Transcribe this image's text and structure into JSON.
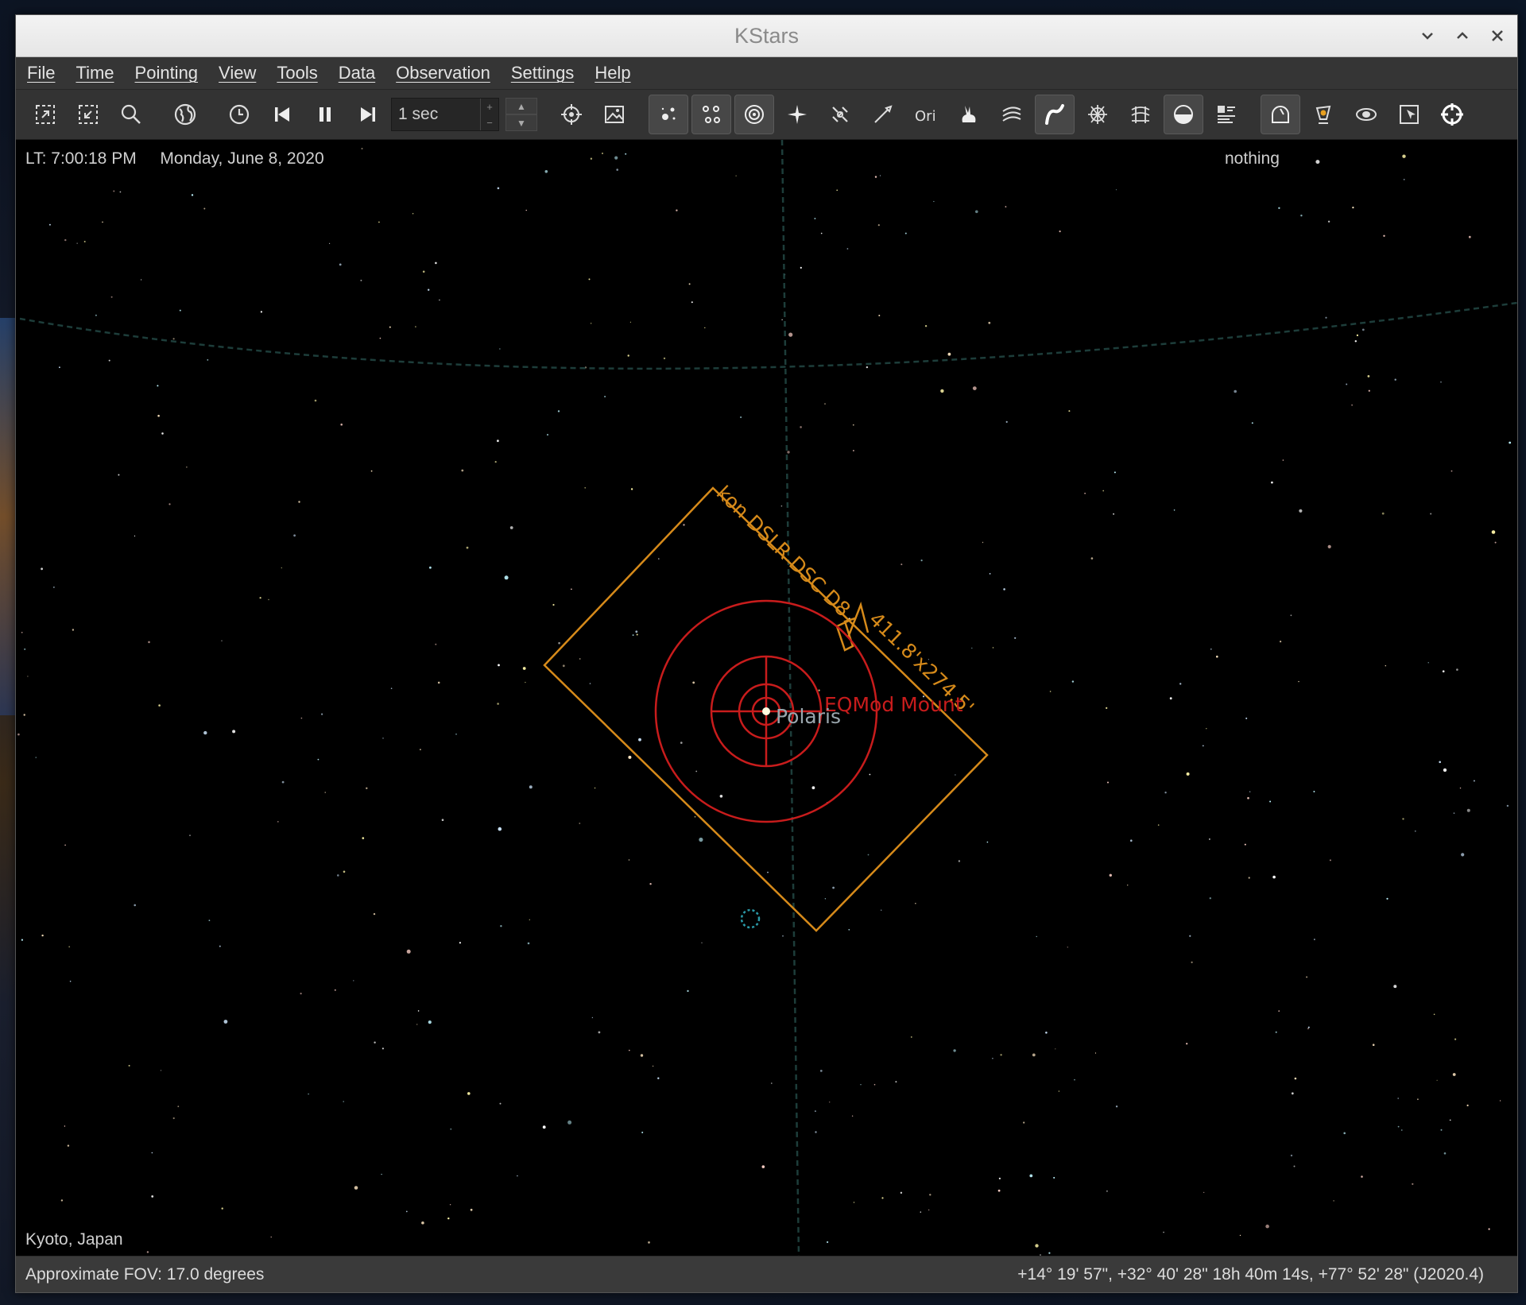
{
  "window": {
    "title": "KStars"
  },
  "menu": [
    "File",
    "Time",
    "Pointing",
    "View",
    "Tools",
    "Data",
    "Observation",
    "Settings",
    "Help"
  ],
  "toolbar": {
    "time_step": "1 sec",
    "icons": [
      "zoom-in-icon",
      "zoom-out-icon",
      "search-icon",
      "globe-icon",
      "clock-icon",
      "skip-back-icon",
      "pause-icon",
      "skip-forward-icon",
      "target-icon",
      "image-icon",
      "stars-icon",
      "constellation-icon",
      "deep-sky-icon",
      "bright-star-icon",
      "satellite-icon",
      "comet-icon",
      "constellation-names-icon",
      "rabbit-icon",
      "milky-way-icon",
      "constellation-lines-icon",
      "grid-icon",
      "equatorial-icon",
      "horizon-icon",
      "details-icon",
      "observatory-icon",
      "telescope-icon",
      "galaxy-icon",
      "export-icon",
      "crosshair-icon"
    ]
  },
  "sky": {
    "local_time": "LT: 7:00:18 PM",
    "date": "Monday, June 8, 2020",
    "focus_object": "nothing",
    "location": "Kyoto, Japan",
    "star_label": "Polaris",
    "fov_label": "kon DSLR DSC D8",
    "fov_size": "411.8'x274.5'",
    "mount_label": "EQMod Mount"
  },
  "status": {
    "fov": "Approximate FOV: 17.0 degrees",
    "coords": "+14° 19' 57\", +32° 40' 28\"  18h 40m 14s, +77° 52' 28\" (J2020.4)"
  },
  "colors": {
    "fov": "#d68a1a",
    "mount": "#c81c1c",
    "label": "#9aa6ad"
  }
}
